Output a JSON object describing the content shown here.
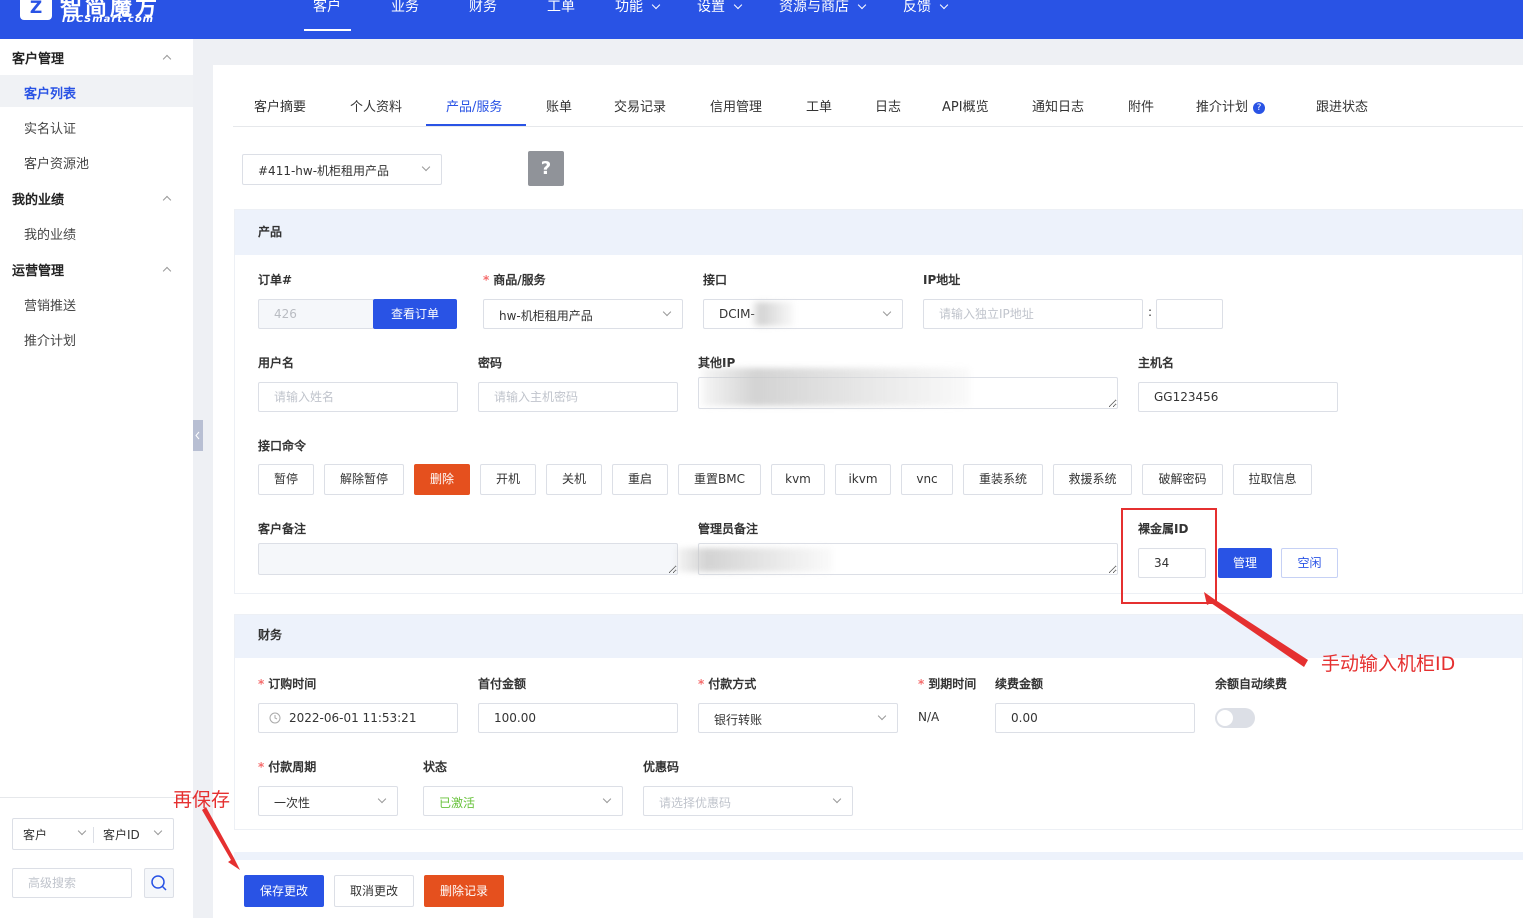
{
  "brand": {
    "name": "智简魔方",
    "sub": "IDCSmart.com"
  },
  "topnav": [
    {
      "label": "客户",
      "active": true
    },
    {
      "label": "业务"
    },
    {
      "label": "财务"
    },
    {
      "label": "工单"
    },
    {
      "label": "功能",
      "dropdown": true
    },
    {
      "label": "设置",
      "dropdown": true
    },
    {
      "label": "资源与商店",
      "dropdown": true
    },
    {
      "label": "反馈",
      "dropdown": true
    }
  ],
  "sidebar": {
    "groups": [
      {
        "title": "客户管理",
        "items": [
          "客户列表",
          "实名认证",
          "客户资源池"
        ]
      },
      {
        "title": "我的业绩",
        "items": [
          "我的业绩"
        ]
      },
      {
        "title": "运营管理",
        "items": [
          "营销推送",
          "推介计划"
        ]
      }
    ],
    "active_item": "客户列表",
    "search": {
      "type_value": "客户",
      "field_value": "客户ID",
      "advanced_placeholder": "高级搜索"
    }
  },
  "tabs": [
    "客户摘要",
    "个人资料",
    "产品/服务",
    "账单",
    "交易记录",
    "信用管理",
    "工单",
    "日志",
    "API概览",
    "通知日志",
    "附件",
    "推介计划",
    "跟进状态"
  ],
  "active_tab": "产品/服务",
  "product_selector": "#411-hw-机柜租用产品",
  "help_button": "?",
  "product_section": {
    "title": "产品",
    "order_label": "订单#",
    "order_value": "426",
    "view_order_button": "查看订单",
    "goods_label": "商品/服务",
    "goods_value": "hw-机柜租用产品",
    "interface_label": "接口",
    "interface_value": "DCIM-",
    "ip_label": "IP地址",
    "ip_placeholder": "请输入独立IP地址",
    "port_sep": ":",
    "username_label": "用户名",
    "username_placeholder": "请输入姓名",
    "password_label": "密码",
    "password_placeholder": "请输入主机密码",
    "other_ip_label": "其他IP",
    "hostname_label": "主机名",
    "hostname_value": "GG123456",
    "commands_label": "接口命令",
    "commands": [
      "暂停",
      "解除暂停",
      "删除",
      "开机",
      "关机",
      "重启",
      "重置BMC",
      "kvm",
      "ikvm",
      "vnc",
      "重装系统",
      "救援系统",
      "破解密码",
      "拉取信息"
    ],
    "customer_note_label": "客户备注",
    "admin_note_label": "管理员备注",
    "baremetal_label": "裸金属ID",
    "baremetal_value": "34",
    "manage_button": "管理",
    "idle_button": "空闲"
  },
  "finance_section": {
    "title": "财务",
    "order_time_label": "订购时间",
    "order_time_value": "2022-06-01 11:53:21",
    "first_pay_label": "首付金额",
    "first_pay_value": "100.00",
    "pay_method_label": "付款方式",
    "pay_method_value": "银行转账",
    "expire_label": "到期时间",
    "expire_value": "N/A",
    "renew_label": "续费金额",
    "renew_value": "0.00",
    "auto_renew_label": "余额自动续费",
    "auto_renew_on": false,
    "cycle_label": "付款周期",
    "cycle_value": "一次性",
    "status_label": "状态",
    "status_value": "已激活",
    "status_color": "#67c23a",
    "coupon_label": "优惠码",
    "coupon_placeholder": "请选择优惠码"
  },
  "footer_buttons": {
    "save": "保存更改",
    "cancel": "取消更改",
    "delete": "删除记录"
  },
  "annotations": {
    "id_note": "手动输入机柜ID",
    "save_note": "再保存",
    "color": "#e53030"
  }
}
